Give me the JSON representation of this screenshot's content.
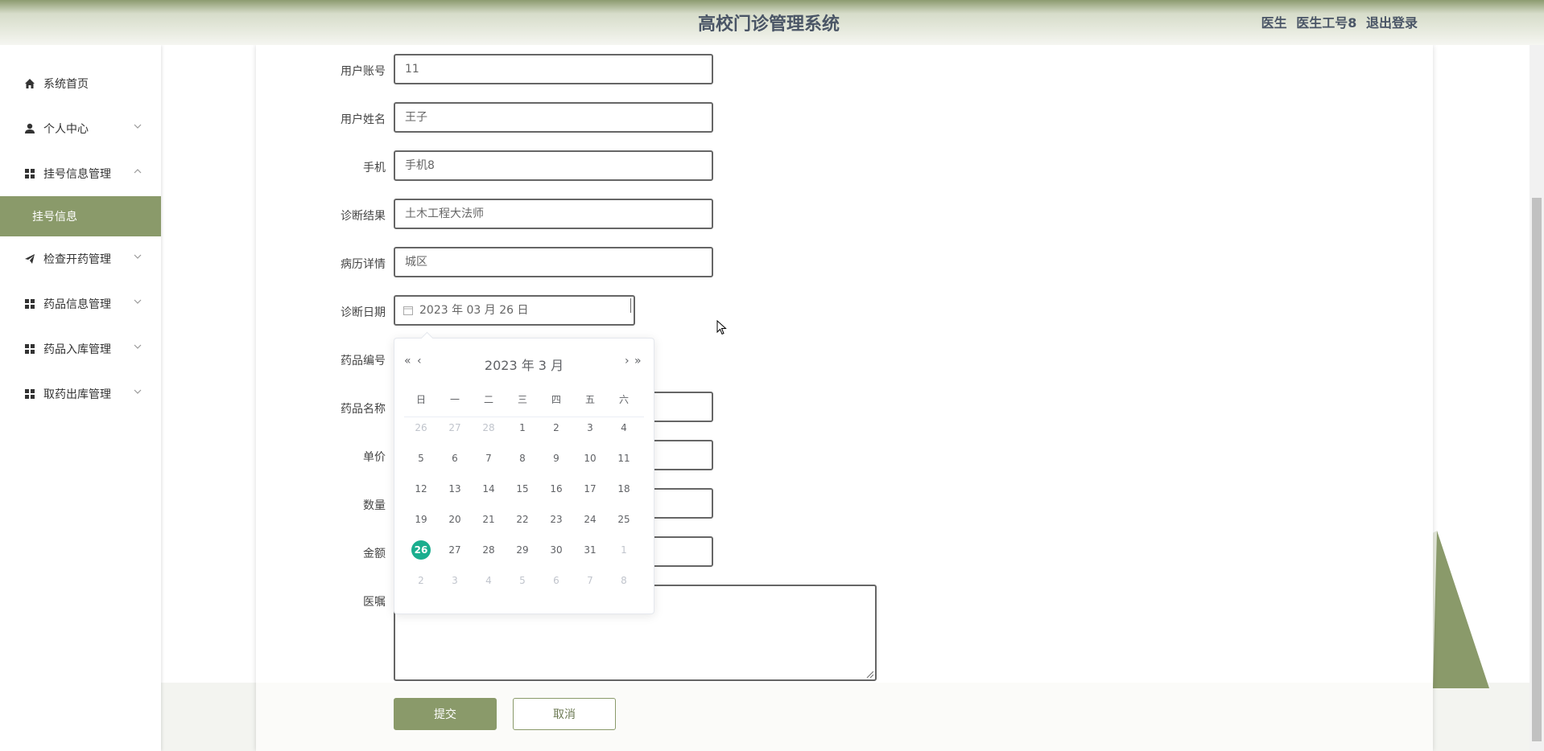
{
  "header": {
    "title": "高校门诊管理系统",
    "role": "医生",
    "user": "医生工号8",
    "logout": "退出登录"
  },
  "sidebar": {
    "items": [
      {
        "label": "系统首页",
        "icon": "home-icon"
      },
      {
        "label": "个人中心",
        "icon": "user-icon"
      },
      {
        "label": "挂号信息管理",
        "icon": "grid-icon"
      },
      {
        "label": "挂号信息",
        "icon": ""
      },
      {
        "label": "检查开药管理",
        "icon": "send-icon"
      },
      {
        "label": "药品信息管理",
        "icon": "grid-icon"
      },
      {
        "label": "药品入库管理",
        "icon": "grid-icon"
      },
      {
        "label": "取药出库管理",
        "icon": "grid-icon"
      }
    ]
  },
  "form": {
    "fields": [
      {
        "label": "用户账号",
        "value": "11"
      },
      {
        "label": "用户姓名",
        "value": "王子"
      },
      {
        "label": "手机",
        "value": "手机8"
      },
      {
        "label": "诊断结果",
        "value": "土木工程大法师"
      },
      {
        "label": "病历详情",
        "value": "城区"
      },
      {
        "label": "诊断日期",
        "value": "2023 年 03 月 26 日"
      },
      {
        "label": "药品编号",
        "value": ""
      },
      {
        "label": "药品名称",
        "value": ""
      },
      {
        "label": "单价",
        "value": ""
      },
      {
        "label": "数量",
        "value": ""
      },
      {
        "label": "金额",
        "value": ""
      },
      {
        "label": "医嘱",
        "value": ""
      }
    ],
    "submit": "提交",
    "cancel": "取消"
  },
  "datepicker": {
    "prev_year": "«",
    "prev_month": "‹",
    "next_month": "›",
    "next_year": "»",
    "title": "2023 年  3 月",
    "weekdays": [
      "日",
      "一",
      "二",
      "三",
      "四",
      "五",
      "六"
    ],
    "selected": "26",
    "rows": [
      [
        {
          "d": "26",
          "o": true
        },
        {
          "d": "27",
          "o": true
        },
        {
          "d": "28",
          "o": true
        },
        {
          "d": "1"
        },
        {
          "d": "2"
        },
        {
          "d": "3"
        },
        {
          "d": "4"
        }
      ],
      [
        {
          "d": "5"
        },
        {
          "d": "6"
        },
        {
          "d": "7"
        },
        {
          "d": "8"
        },
        {
          "d": "9"
        },
        {
          "d": "10"
        },
        {
          "d": "11"
        }
      ],
      [
        {
          "d": "12"
        },
        {
          "d": "13"
        },
        {
          "d": "14"
        },
        {
          "d": "15"
        },
        {
          "d": "16"
        },
        {
          "d": "17"
        },
        {
          "d": "18"
        }
      ],
      [
        {
          "d": "19"
        },
        {
          "d": "20"
        },
        {
          "d": "21"
        },
        {
          "d": "22"
        },
        {
          "d": "23"
        },
        {
          "d": "24"
        },
        {
          "d": "25"
        }
      ],
      [
        {
          "d": "26",
          "s": true
        },
        {
          "d": "27"
        },
        {
          "d": "28"
        },
        {
          "d": "29"
        },
        {
          "d": "30"
        },
        {
          "d": "31"
        },
        {
          "d": "1",
          "o": true
        }
      ],
      [
        {
          "d": "2",
          "o": true
        },
        {
          "d": "3",
          "o": true
        },
        {
          "d": "4",
          "o": true
        },
        {
          "d": "5",
          "o": true
        },
        {
          "d": "6",
          "o": true
        },
        {
          "d": "7",
          "o": true
        },
        {
          "d": "8",
          "o": true
        }
      ]
    ]
  },
  "colors": {
    "accent": "#8a9a6a",
    "selected_day": "#1aae8e"
  }
}
